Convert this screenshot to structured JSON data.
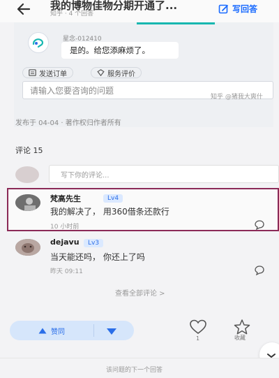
{
  "header": {
    "title": "我的博物佳物分期开通了...",
    "subtitle": "知乎 · 4 个回答",
    "write_label": "写回答"
  },
  "chat_card": {
    "bot_name": "星念-012410",
    "message": "是的。给您添麻烦了。",
    "buttons": [
      {
        "label": "发送订单",
        "icon": "order-icon"
      },
      {
        "label": "服务评价",
        "icon": "rating-icon"
      }
    ],
    "input_placeholder": "请输入您要咨询的问题",
    "watermark": "知乎 @猪我大爽什"
  },
  "publish_info": "发布于 04-04 · 著作权归作者所有",
  "comments": {
    "header": "评论 15",
    "input_placeholder": "写下你的评论...",
    "items": [
      {
        "name": "梵高先生",
        "level": "Lv4",
        "text": "我的解决了， 用360借条还款行",
        "time": "10 小时前"
      },
      {
        "name": "dejavu",
        "level": "Lv3",
        "text": "当天能还吗， 你还上了吗",
        "time": "昨天 09:11"
      }
    ],
    "view_all": "查看全部评论 >"
  },
  "actions": {
    "upvote_label": "赞同",
    "like_count": "1",
    "favorite_label": "收藏"
  },
  "bottom_hint": "该问题的下一个回答",
  "colors": {
    "accent": "#1769ff",
    "highlight_border": "#8b2a57",
    "teal": "#17b7b0"
  }
}
